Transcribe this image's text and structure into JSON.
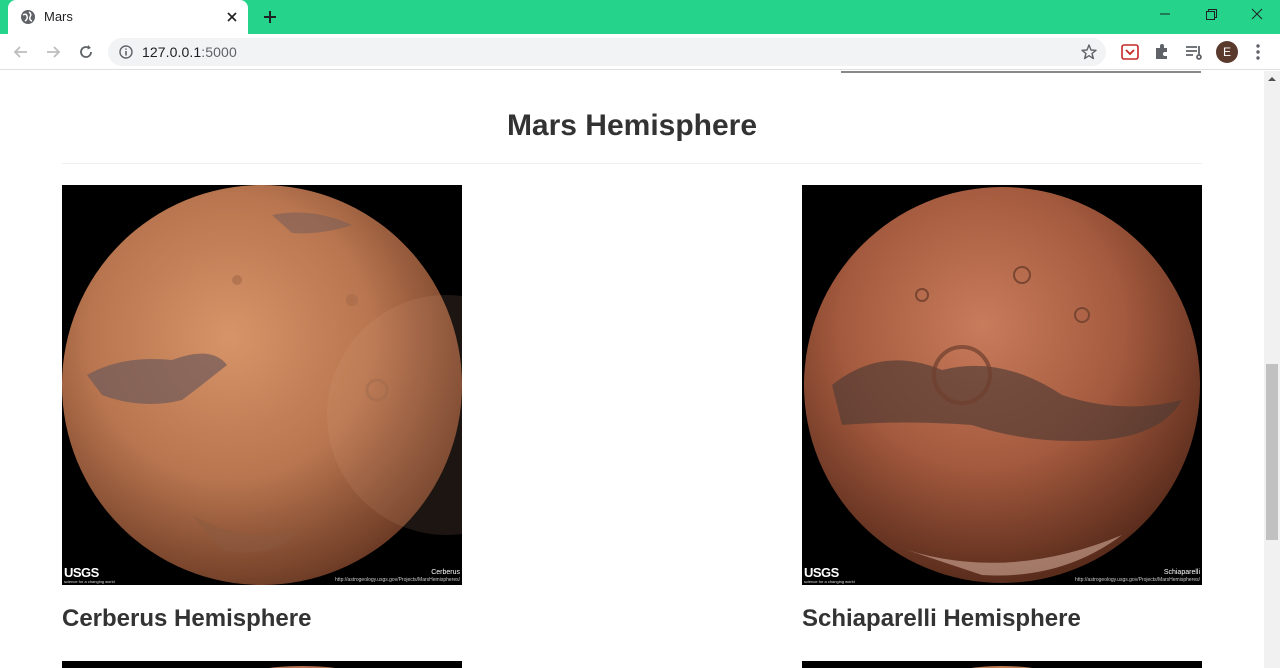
{
  "browser": {
    "tab_title": "Mars",
    "url_host": "127.0.0.1",
    "url_port": ":5000",
    "profile_initial": "E",
    "accent_color": "#25d38b"
  },
  "page": {
    "section_title": "Mars Hemisphere",
    "hemispheres": [
      {
        "title": "Cerberus Hemisphere",
        "image_brand": "USGS",
        "image_tagline": "science for a changing world",
        "image_name": "Cerberus",
        "image_url": "http://astrogeology.usgs.gov/Projects/MarsHemispheres/"
      },
      {
        "title": "Schiaparelli Hemisphere",
        "image_brand": "USGS",
        "image_tagline": "science for a changing world",
        "image_name": "Schiaparelli",
        "image_url": "http://astrogeology.usgs.gov/Projects/MarsHemispheres/"
      }
    ]
  }
}
